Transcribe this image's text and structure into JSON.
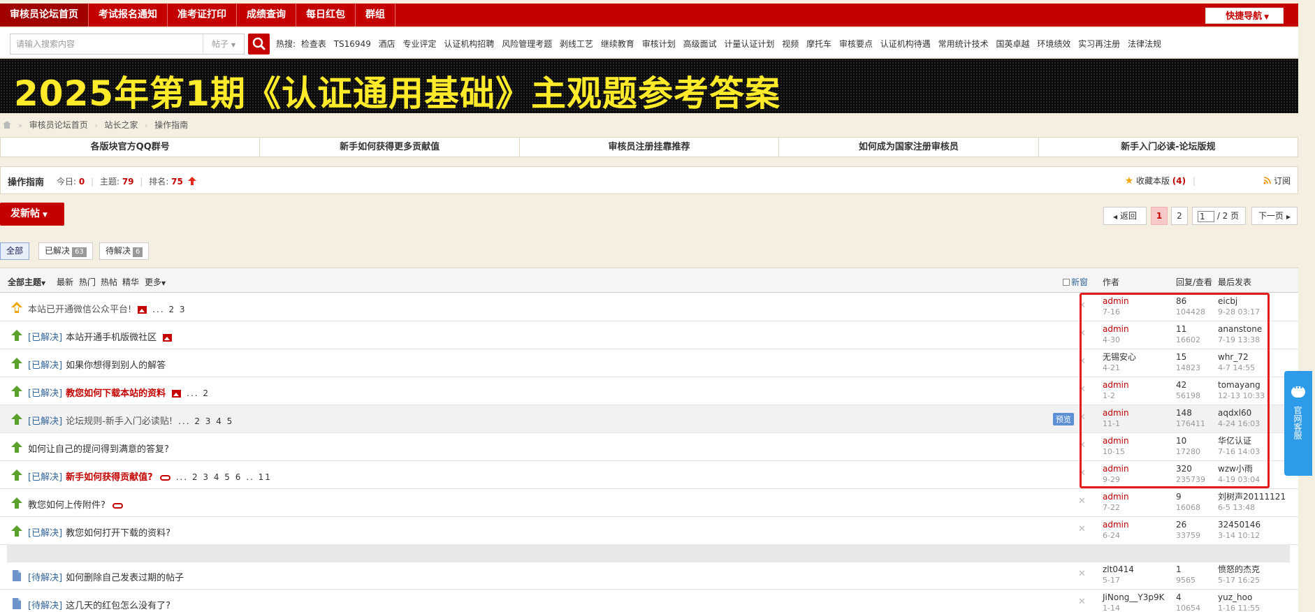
{
  "topnav": {
    "items": [
      "审核员论坛首页",
      "考试报名通知",
      "准考证打印",
      "成绩查询",
      "每日红包",
      "群组"
    ],
    "quick_nav": "快捷导航"
  },
  "search": {
    "placeholder": "请输入搜索内容",
    "type": "帖子",
    "hot_label": "热搜:",
    "hot_keywords": [
      "检查表",
      "TS16949",
      "酒店",
      "专业评定",
      "认证机构招聘",
      "风险管理考题",
      "剥线工艺",
      "继续教育",
      "审核计划",
      "高级面试",
      "计量认证计划",
      "视频",
      "摩托车",
      "审核要点",
      "认证机构待遇",
      "常用统计技术",
      "国英卓越",
      "环境绩效",
      "实习再注册",
      "法律法规"
    ]
  },
  "banner": {
    "text": "2025年第1期《认证通用基础》主观题参考答案"
  },
  "breadcrumb": [
    "审核员论坛首页",
    "站长之家",
    "操作指南"
  ],
  "quicklinks": [
    "各版块官方QQ群号",
    "新手如何获得更多贡献值",
    "审核员注册挂靠推荐",
    "如何成为国家注册审核员",
    "新手入门必读-论坛版规"
  ],
  "forum": {
    "name": "操作指南",
    "today_label": "今日:",
    "today": "0",
    "topics_label": "主题:",
    "topics": "79",
    "rank_label": "排名:",
    "rank": "75",
    "fav_label": "收藏本版",
    "fav_count": "(4)",
    "subscribe": "订阅"
  },
  "actions": {
    "new_post": "发新帖"
  },
  "pager": {
    "back": "返回",
    "page1": "1",
    "page2": "2",
    "current": "1",
    "total": "/ 2 页",
    "next": "下一页"
  },
  "filter_tabs": {
    "all": "全部",
    "solved": "已解决",
    "solved_count": "63",
    "pending": "待解决",
    "pending_count": "6"
  },
  "thead": {
    "all_topics": "全部主题",
    "latest": "最新",
    "hot": "热门",
    "hot_posts": "热帖",
    "digest": "精华",
    "more": "更多",
    "new_window": "新窗",
    "author": "作者",
    "replies_views": "回复/查看",
    "last_post": "最后发表"
  },
  "threads": [
    {
      "tag": "",
      "title": "本站已开通微信公众平台!",
      "style": "gray",
      "img": true,
      "clip": false,
      "pages": "... 2 3",
      "author": "admin",
      "author_date": "7-16",
      "replies": "86",
      "views": "104428",
      "last_user": "eicbj",
      "last_date": "9-28 03:17"
    },
    {
      "tag": "[已解决]",
      "title": "本站开通手机版微社区",
      "style": "",
      "img": true,
      "clip": false,
      "pages": "",
      "author": "admin",
      "author_date": "4-30",
      "replies": "11",
      "views": "16602",
      "last_user": "ananstone",
      "last_date": "7-19 13:38"
    },
    {
      "tag": "[已解决]",
      "title": "如果你想得到别人的解答",
      "style": "",
      "img": false,
      "clip": false,
      "pages": "",
      "author": "无锡安心",
      "author_date": "4-21",
      "replies": "15",
      "views": "14823",
      "last_user": "whr_72",
      "last_date": "4-7 14:55"
    },
    {
      "tag": "[已解决]",
      "title": "教您如何下载本站的资料",
      "style": "red",
      "img": true,
      "clip": false,
      "pages": "... 2",
      "author": "admin",
      "author_date": "1-2",
      "replies": "42",
      "views": "56198",
      "last_user": "tomayang",
      "last_date": "12-13 10:33"
    },
    {
      "tag": "[已解决]",
      "title": "论坛规则-新手入门必读贴!",
      "style": "gray",
      "img": false,
      "clip": false,
      "pages": "... 2 3 4 5",
      "preview": "预览",
      "author": "admin",
      "author_date": "11-1",
      "replies": "148",
      "views": "176411",
      "last_user": "aqdxl60",
      "last_date": "4-24 16:03"
    },
    {
      "tag": "",
      "title": "如何让自己的提问得到满意的答复?",
      "style": "",
      "img": false,
      "clip": false,
      "pages": "",
      "author": "admin",
      "author_date": "10-15",
      "replies": "10",
      "views": "17280",
      "last_user": "华亿认证",
      "last_date": "7-16 14:03"
    },
    {
      "tag": "[已解决]",
      "title": "新手如何获得贡献值?",
      "style": "red",
      "img": false,
      "clip": true,
      "pages": "... 2 3 4 5 6 .. 11",
      "author": "admin",
      "author_date": "9-29",
      "replies": "320",
      "views": "235739",
      "last_user": "wzw小雨",
      "last_date": "4-19 03:04"
    },
    {
      "tag": "",
      "title": "教您如何上传附件?",
      "style": "",
      "img": false,
      "clip": true,
      "pages": "",
      "author": "admin",
      "author_date": "7-22",
      "replies": "9",
      "views": "16068",
      "last_user": "刘树声20111121",
      "last_date": "6-5 13:48"
    },
    {
      "tag": "[已解决]",
      "title": "教您如何打开下载的资料?",
      "style": "",
      "img": false,
      "clip": false,
      "pages": "",
      "author": "admin",
      "author_date": "6-24",
      "replies": "26",
      "views": "33759",
      "last_user": "32450146",
      "last_date": "3-14 10:12"
    },
    {
      "tag": "[待解决]",
      "title": "如何删除自己发表过期的帖子",
      "style": "",
      "img": false,
      "clip": false,
      "pages": "",
      "author": "zlt0414",
      "author_date": "5-17",
      "replies": "1",
      "views": "9565",
      "last_user": "愤怒的杰克",
      "last_date": "5-17 16:25"
    },
    {
      "tag": "[待解决]",
      "title": "这几天的红包怎么没有了?",
      "style": "",
      "img": false,
      "clip": false,
      "pages": "",
      "author": "JiNong__Y3p9K",
      "author_date": "1-14",
      "replies": "4",
      "views": "10654",
      "last_user": "yuz_hoo",
      "last_date": "1-16 11:55"
    }
  ],
  "service": {
    "text": "官网客服"
  },
  "colors": {
    "brand": "#c40000",
    "link": "#336699",
    "highlight_box": "#e31b1b",
    "service": "#2e9bea"
  }
}
